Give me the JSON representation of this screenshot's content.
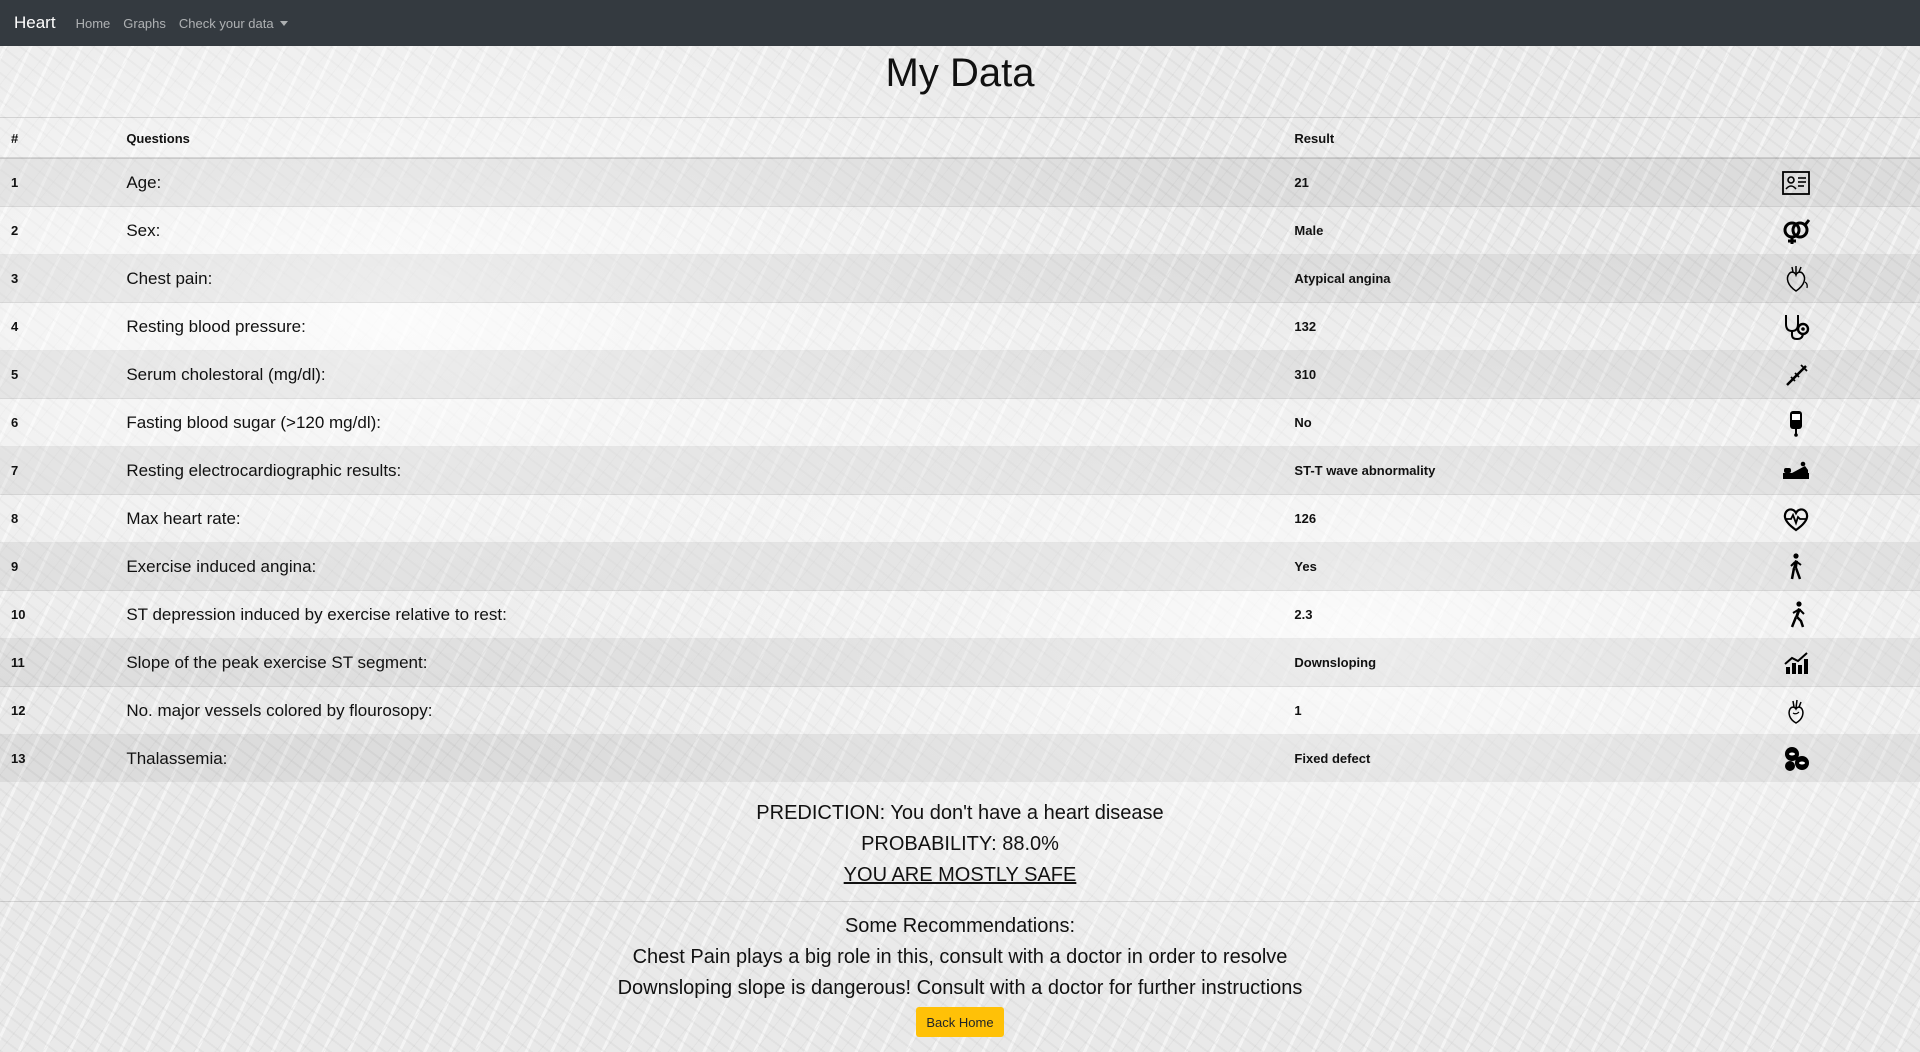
{
  "nav": {
    "brand": "Heart",
    "links": [
      "Home",
      "Graphs"
    ],
    "dropdown": "Check your data"
  },
  "page": {
    "title": "My Data"
  },
  "table": {
    "headers": [
      "#",
      "Questions",
      "Result"
    ],
    "rows": [
      {
        "num": "1",
        "question": "Age:",
        "result": "21",
        "icon": "id-card-icon"
      },
      {
        "num": "2",
        "question": "Sex:",
        "result": "Male",
        "icon": "gender-icon"
      },
      {
        "num": "3",
        "question": "Chest pain:",
        "result": "Atypical angina",
        "icon": "heart-organ-icon"
      },
      {
        "num": "4",
        "question": "Resting blood pressure:",
        "result": "132",
        "icon": "stethoscope-icon"
      },
      {
        "num": "5",
        "question": "Serum cholestoral (mg/dl):",
        "result": "310",
        "icon": "syringe-icon"
      },
      {
        "num": "6",
        "question": "Fasting blood sugar (>120 mg/dl):",
        "result": "No",
        "icon": "glucose-meter-icon"
      },
      {
        "num": "7",
        "question": "Resting electrocardiographic results:",
        "result": "ST-T wave abnormality",
        "icon": "hospital-bed-icon"
      },
      {
        "num": "8",
        "question": "Max heart rate:",
        "result": "126",
        "icon": "heartbeat-icon"
      },
      {
        "num": "9",
        "question": "Exercise induced angina:",
        "result": "Yes",
        "icon": "walking-person-icon"
      },
      {
        "num": "10",
        "question": "ST depression induced by exercise relative to rest:",
        "result": "2.3",
        "icon": "running-person-icon"
      },
      {
        "num": "11",
        "question": "Slope of the peak exercise ST segment:",
        "result": "Downsloping",
        "icon": "chart-growth-icon"
      },
      {
        "num": "12",
        "question": "No. major vessels colored by flourosopy:",
        "result": "1",
        "icon": "heart-vessels-icon"
      },
      {
        "num": "13",
        "question": "Thalassemia:",
        "result": "Fixed defect",
        "icon": "blood-cells-icon"
      }
    ]
  },
  "prediction": {
    "line1": "PREDICTION: You don't have a heart disease",
    "line2": "PROBABILITY: 88.0%",
    "line3": "YOU ARE MOSTLY SAFE"
  },
  "recommendations": {
    "heading": "Some Recommendations:",
    "items": [
      "Chest Pain plays a big role in this, consult with a doctor in order to resolve",
      "Downsloping slope is dangerous! Consult with a doctor for further instructions"
    ]
  },
  "buttons": {
    "back_home": "Back Home"
  },
  "colors": {
    "navbar": "#343a40",
    "button": "#ffc107"
  }
}
